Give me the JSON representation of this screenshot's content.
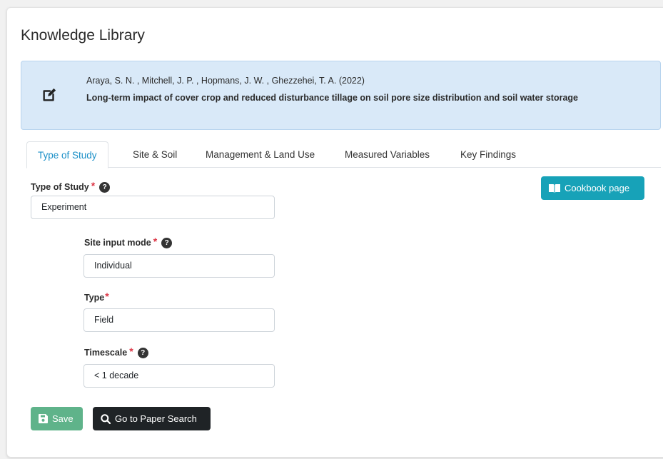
{
  "page": {
    "title": "Knowledge Library"
  },
  "paper": {
    "authors": "Araya, S. N. , Mitchell, J. P. , Hopmans, J. W. , Ghezzehei, T. A. (2022)",
    "title": "Long-term impact of cover crop and reduced disturbance tillage on soil pore size distribution and soil water storage",
    "icon": "edit-icon"
  },
  "tabs": [
    {
      "label": "Type of Study",
      "active": true
    },
    {
      "label": "Site & Soil",
      "active": false
    },
    {
      "label": "Management & Land Use",
      "active": false
    },
    {
      "label": "Measured Variables",
      "active": false
    },
    {
      "label": "Key Findings",
      "active": false
    }
  ],
  "form": {
    "type_of_study": {
      "label": "Type of Study",
      "required": "*",
      "help": "?",
      "value": "Experiment"
    },
    "site_input_mode": {
      "label": "Site input mode",
      "required": "*",
      "help": "?",
      "value": "Individual"
    },
    "type": {
      "label": "Type",
      "required": "*",
      "value": "Field"
    },
    "timescale": {
      "label": "Timescale",
      "required": "*",
      "help": "?",
      "value": "< 1 decade"
    }
  },
  "buttons": {
    "cookbook": "Cookbook page",
    "save": "Save",
    "search": "Go to Paper Search"
  },
  "colors": {
    "accent": "#1a8fc7",
    "info": "#17a2b8",
    "success": "#5fb38a",
    "dark": "#1f2326",
    "required": "#dc3545",
    "paper_bg": "#d9e9f8"
  }
}
